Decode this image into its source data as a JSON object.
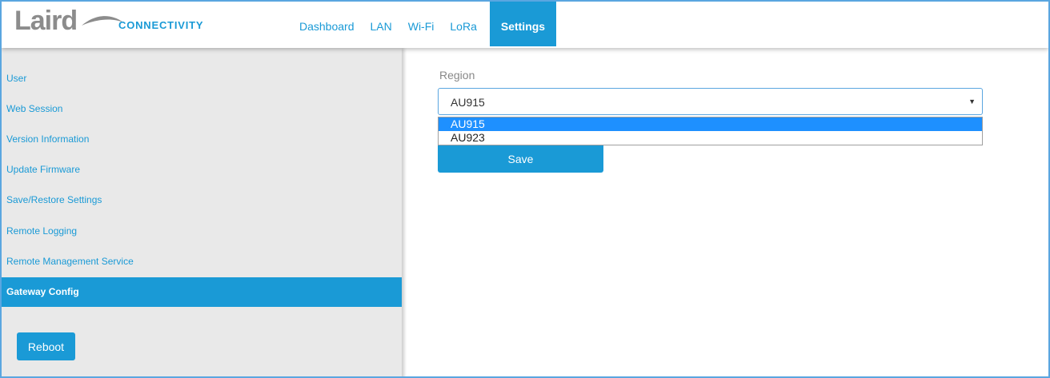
{
  "brand": {
    "name": "Laird",
    "tagline": "CONNECTIVITY",
    "accent": "#1a9ad6"
  },
  "nav": {
    "items": [
      {
        "label": "Dashboard"
      },
      {
        "label": "LAN"
      },
      {
        "label": "Wi-Fi"
      },
      {
        "label": "LoRa"
      },
      {
        "label": "Settings"
      }
    ],
    "active": "Settings"
  },
  "sidebar": {
    "items": [
      {
        "label": "User"
      },
      {
        "label": "Web Session"
      },
      {
        "label": "Version Information"
      },
      {
        "label": "Update Firmware"
      },
      {
        "label": "Save/Restore Settings"
      },
      {
        "label": "Remote Logging"
      },
      {
        "label": "Remote Management Service"
      },
      {
        "label": "Gateway Config"
      }
    ],
    "active": "Gateway Config",
    "reboot_label": "Reboot"
  },
  "main": {
    "region_label": "Region",
    "region_value": "AU915",
    "region_options": [
      "AU915",
      "AU923"
    ],
    "save_label": "Save"
  }
}
